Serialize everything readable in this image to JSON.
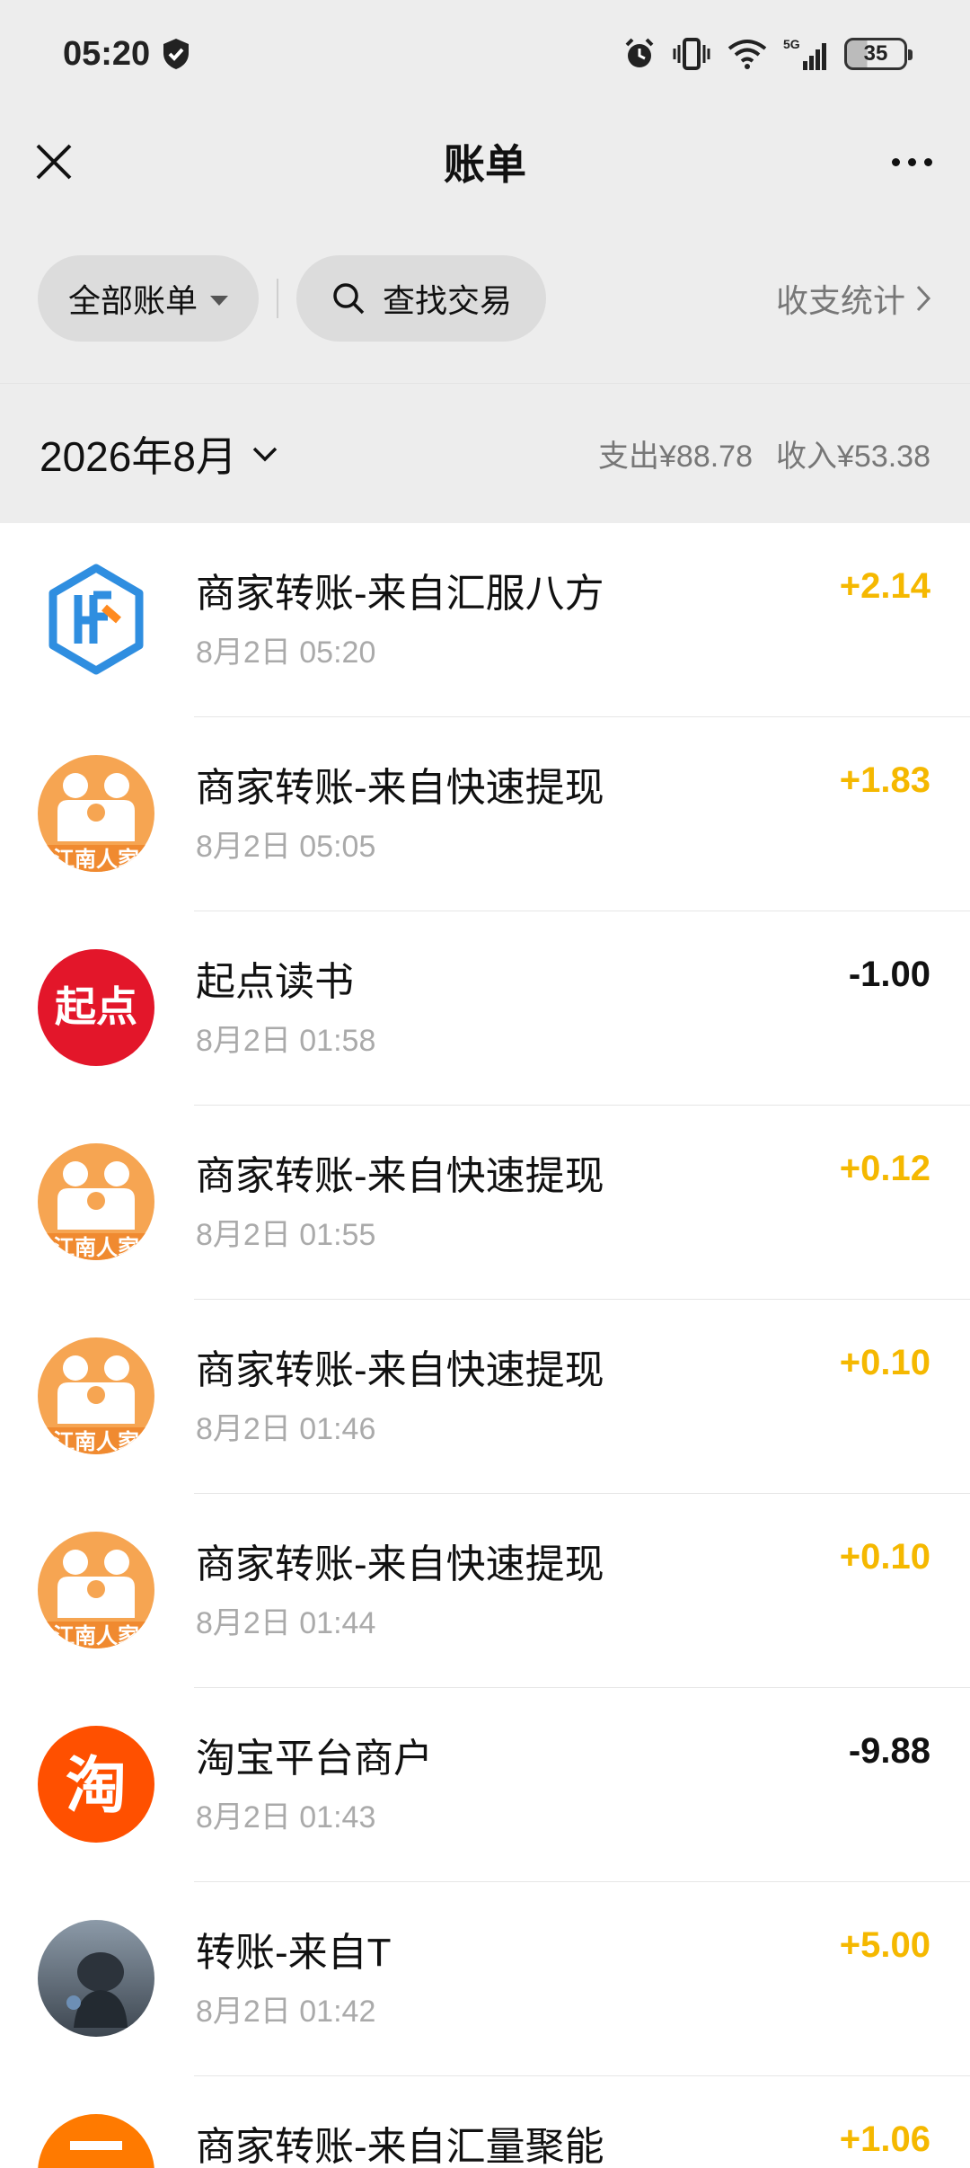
{
  "status": {
    "time": "05:20",
    "battery": "35",
    "network": "5G"
  },
  "header": {
    "title": "账单"
  },
  "filters": {
    "all_bills": "全部账单",
    "search": "查找交易",
    "stats": "收支统计"
  },
  "month": {
    "label": "2026年8月",
    "expense": "支出¥88.78",
    "income": "收入¥53.38"
  },
  "transactions": [
    {
      "name": "商家转账-来自汇服八方",
      "time": "8月2日 05:20",
      "amount": "+2.14",
      "icon": "hf-logo-icon"
    },
    {
      "name": "商家转账-来自快速提现",
      "time": "8月2日 05:05",
      "amount": "+1.83",
      "icon": "family-logo-icon"
    },
    {
      "name": "起点读书",
      "time": "8月2日 01:58",
      "amount": "-1.00",
      "icon": "qidian-logo-icon"
    },
    {
      "name": "商家转账-来自快速提现",
      "time": "8月2日 01:55",
      "amount": "+0.12",
      "icon": "family-logo-icon"
    },
    {
      "name": "商家转账-来自快速提现",
      "time": "8月2日 01:46",
      "amount": "+0.10",
      "icon": "family-logo-icon"
    },
    {
      "name": "商家转账-来自快速提现",
      "time": "8月2日 01:44",
      "amount": "+0.10",
      "icon": "family-logo-icon"
    },
    {
      "name": "淘宝平台商户",
      "time": "8月2日 01:43",
      "amount": "-9.88",
      "icon": "taobao-logo-icon"
    },
    {
      "name": "转账-来自T",
      "time": "8月2日 01:42",
      "amount": "+5.00",
      "icon": "user-avatar"
    },
    {
      "name": "商家转账-来自汇量聚能",
      "time": "",
      "amount": "+1.06",
      "icon": "merchant-logo-icon"
    }
  ],
  "colors": {
    "income": "#f5b800",
    "expense": "#111111",
    "background": "#ededed"
  }
}
